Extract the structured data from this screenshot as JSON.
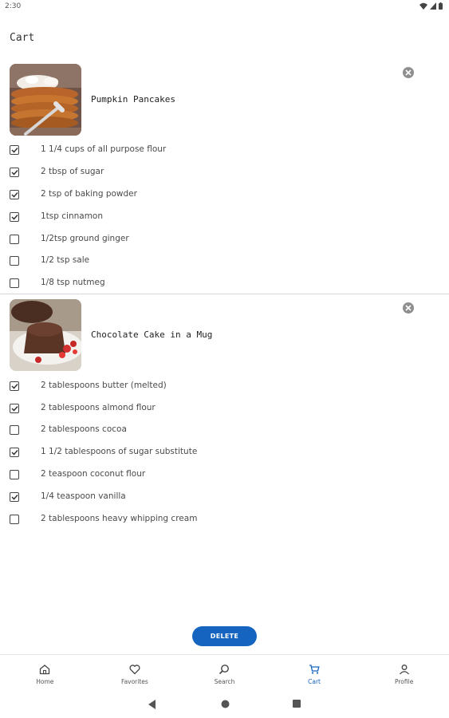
{
  "status": {
    "time": "2:30"
  },
  "page": {
    "title": "Cart"
  },
  "recipes": [
    {
      "title": "Pumpkin Pancakes",
      "image": "pumpkin-pancakes-photo",
      "ingredients": [
        {
          "text": "1 1/4 cups of all purpose flour",
          "checked": true
        },
        {
          "text": "2 tbsp of sugar",
          "checked": true
        },
        {
          "text": "2 tsp of baking powder",
          "checked": true
        },
        {
          "text": "1tsp cinnamon",
          "checked": true
        },
        {
          "text": "1/2tsp ground ginger",
          "checked": false
        },
        {
          "text": "1/2 tsp sale",
          "checked": false
        },
        {
          "text": "1/8 tsp nutmeg",
          "checked": false
        }
      ]
    },
    {
      "title": "Chocolate Cake in a Mug",
      "image": "chocolate-cake-photo",
      "ingredients": [
        {
          "text": "2 tablespoons butter (melted)",
          "checked": true
        },
        {
          "text": "2 tablespoons almond flour",
          "checked": true
        },
        {
          "text": "2 tablespoons cocoa",
          "checked": false
        },
        {
          "text": "1 1/2 tablespoons of sugar substitute",
          "checked": true
        },
        {
          "text": "2 teaspoon coconut flour",
          "checked": false
        },
        {
          "text": "1/4 teaspoon vanilla",
          "checked": true
        },
        {
          "text": "2 tablespoons heavy whipping cream",
          "checked": false
        }
      ]
    }
  ],
  "actions": {
    "delete_label": "DELETE"
  },
  "nav": {
    "items": [
      {
        "label": "Home",
        "icon": "home-icon"
      },
      {
        "label": "Favorites",
        "icon": "heart-icon"
      },
      {
        "label": "Search",
        "icon": "search-icon"
      },
      {
        "label": "Cart",
        "icon": "cart-icon",
        "active": true
      },
      {
        "label": "Profile",
        "icon": "person-icon"
      }
    ]
  },
  "colors": {
    "accent": "#1565c0",
    "active_nav": "#1565c0"
  }
}
